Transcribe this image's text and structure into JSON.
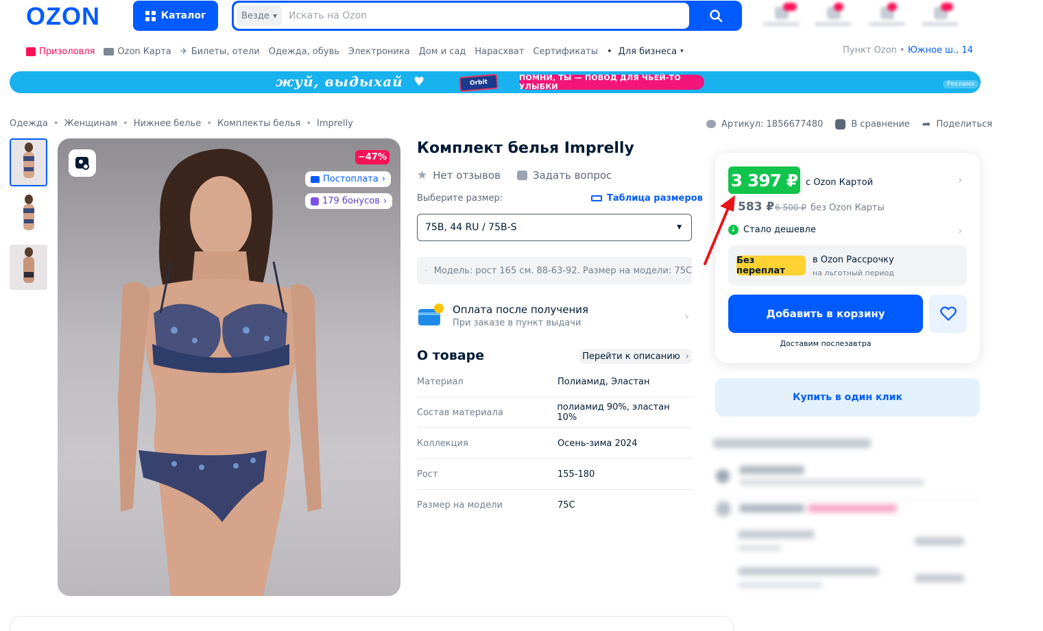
{
  "header": {
    "logo": "OZON",
    "catalog_label": "Каталог",
    "search_scope": "Везде",
    "search_placeholder": "Искать на Ozon"
  },
  "nav": {
    "items": [
      {
        "label": "Призоловля",
        "icon": "gift-icon"
      },
      {
        "label": "Ozon Карта",
        "icon": "card-icon"
      },
      {
        "label": "Билеты, отели",
        "icon": "plane-icon"
      },
      {
        "label": "Одежда, обувь"
      },
      {
        "label": "Электроника"
      },
      {
        "label": "Дом и сад"
      },
      {
        "label": "Нарасхват"
      },
      {
        "label": "Сертификаты"
      },
      {
        "label": "Для бизнеса"
      }
    ],
    "pickup_label": "Пункт Ozon",
    "pickup_address": "Южное ш., 14"
  },
  "banner": {
    "slogan": "жуй, выдыхай",
    "product": "Orbit",
    "pill": "ПОМНИ, ТЫ — ПОВОД ДЛЯ ЧЬЕЙ-ТО УЛЫБКИ",
    "ad_label": "Реклама"
  },
  "breadcrumbs": [
    "Одежда",
    "Женщинам",
    "Нижнее белье",
    "Комплекты белья",
    "Imprelly"
  ],
  "meta": {
    "article": "Артикул: 1856677480",
    "compare": "В сравнение",
    "share": "Поделиться"
  },
  "gallery": {
    "discount": "−47%",
    "postpay": "Постоплата",
    "bonus": "179 бонусов"
  },
  "product": {
    "title": "Комплект белья Imprelly",
    "no_reviews": "Нет отзывов",
    "ask_question": "Задать вопрос",
    "size_label": "Выберите размер:",
    "size_table": "Таблица размеров",
    "selected_size": "75B, 44 RU / 75B-S",
    "model_info": "Модель: рост 165 см. 88-63-92. Размер на модели: 75C",
    "pay_title": "Оплата после получения",
    "pay_sub": "При заказе в пункт выдачи",
    "about_title": "О товаре",
    "goto_description": "Перейти к описанию",
    "specs": [
      {
        "key": "Материал",
        "value": "Полиамид, Эластан"
      },
      {
        "key": "Состав материала",
        "value": "полиамид 90%, эластан 10%"
      },
      {
        "key": "Коллекция",
        "value": "Осень-зима 2024"
      },
      {
        "key": "Рост",
        "value": "155-180"
      },
      {
        "key": "Размер на модели",
        "value": "75C"
      }
    ]
  },
  "price": {
    "ozon_card_price": "3 397 ₽",
    "ozon_card_label": "с Ozon Картой",
    "regular_price": "583 ₽",
    "old_price": "6 500 ₽",
    "regular_label": "без Ozon Карты",
    "cheaper": "Стало дешевле",
    "installment_badge": "Без переплат",
    "installment_title": "в Ozon Рассрочку",
    "installment_sub": "на льготный период",
    "add_to_cart": "Добавить в корзину",
    "delivery": "Доставим послезавтра",
    "one_click": "Купить в один клик"
  },
  "colors": {
    "brand_blue": "#005bff",
    "price_green": "#10c44c",
    "discount_pink": "#f91155",
    "annotation_red": "#e8141c"
  }
}
